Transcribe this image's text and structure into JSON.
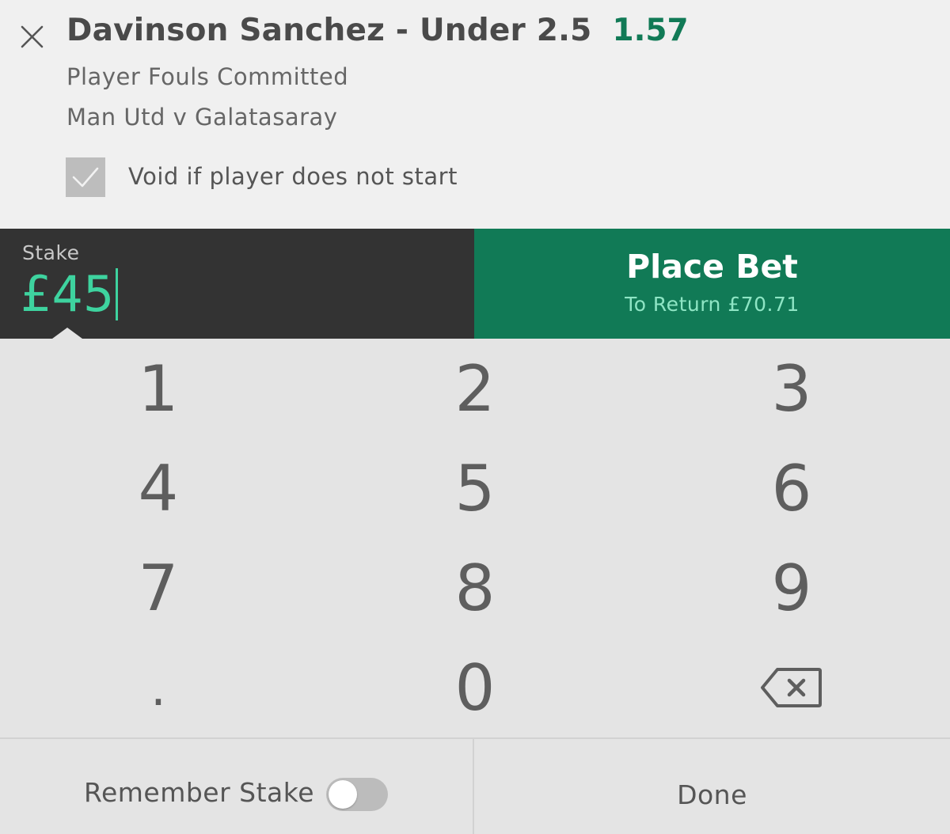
{
  "bet": {
    "selection": "Davinson Sanchez - Under 2.5",
    "odds": "1.57",
    "market": "Player Fouls Committed",
    "event": "Man Utd v Galatasaray",
    "void_label": "Void if player does not start",
    "void_checked": true
  },
  "stake": {
    "label": "Stake",
    "value": "£45"
  },
  "place_bet": {
    "label": "Place Bet",
    "to_return": "To Return £70.71"
  },
  "keypad": {
    "keys": [
      "1",
      "2",
      "3",
      "4",
      "5",
      "6",
      "7",
      "8",
      "9",
      ".",
      "0"
    ],
    "backspace_icon": "backspace-icon"
  },
  "footer": {
    "remember_label": "Remember Stake",
    "remember_on": false,
    "done_label": "Done"
  },
  "colors": {
    "accent_green": "#117a56",
    "stake_green": "#3ed39f",
    "return_green": "#8ee5c4",
    "stake_bg": "#333333"
  },
  "icons": {
    "close": "close-icon",
    "checkbox": "checkmark-icon"
  }
}
